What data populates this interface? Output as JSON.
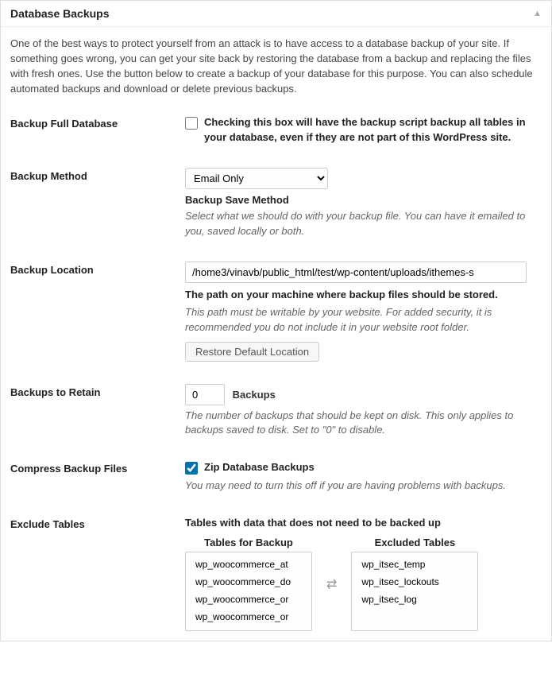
{
  "panel": {
    "title": "Database Backups",
    "intro": "One of the best ways to protect yourself from an attack is to have access to a database backup of your site. If something goes wrong, you can get your site back by restoring the database from a backup and replacing the files with fresh ones. Use the button below to create a backup of your database for this purpose. You can also schedule automated backups and download or delete previous backups."
  },
  "fields": {
    "full_db": {
      "label": "Backup Full Database",
      "checkbox_label": "Checking this box will have the backup script backup all tables in your database, even if they are not part of this WordPress site.",
      "checked": false
    },
    "method": {
      "label": "Backup Method",
      "selected": "Email Only",
      "sub_label": "Backup Save Method",
      "help": "Select what we should do with your backup file. You can have it emailed to you, saved locally or both."
    },
    "location": {
      "label": "Backup Location",
      "value": "/home3/vinavb/public_html/test/wp-content/uploads/ithemes-s",
      "bold_desc": "The path on your machine where backup files should be stored.",
      "help": "This path must be writable by your website. For added security, it is recommended you do not include it in your website root folder.",
      "button": "Restore Default Location"
    },
    "retain": {
      "label": "Backups to Retain",
      "value": "0",
      "suffix": "Backups",
      "help": "The number of backups that should be kept on disk. This only applies to backups saved to disk. Set to \"0\" to disable."
    },
    "compress": {
      "label": "Compress Backup Files",
      "checkbox_label": "Zip Database Backups",
      "checked": true,
      "help": "You may need to turn this off if you are having problems with backups."
    },
    "exclude": {
      "label": "Exclude Tables",
      "bold_desc": "Tables with data that does not need to be backed up",
      "col_backup_title": "Tables for Backup",
      "col_excluded_title": "Excluded Tables",
      "backup_tables": [
        "wp_woocommerce_at",
        "wp_woocommerce_do",
        "wp_woocommerce_or",
        "wp_woocommerce_or"
      ],
      "excluded_tables": [
        "wp_itsec_temp",
        "wp_itsec_lockouts",
        "wp_itsec_log"
      ]
    }
  }
}
